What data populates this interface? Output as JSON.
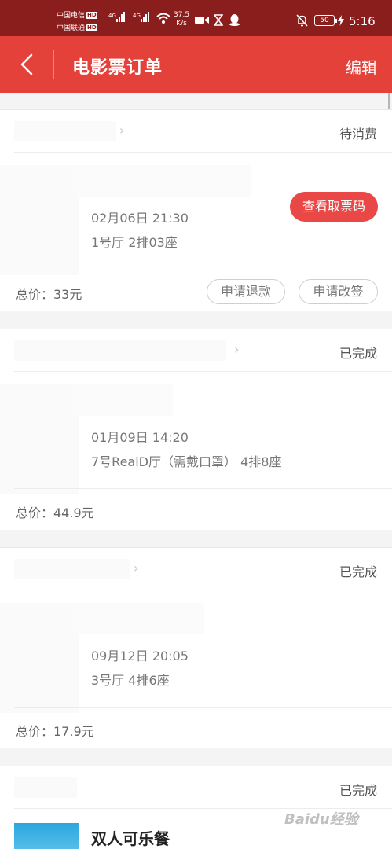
{
  "status_bar": {
    "carrier1": "中国电信",
    "carrier2": "中国联通",
    "hd_label": "HD",
    "sig_label": "4G",
    "net_speed_value": "37.5",
    "net_speed_unit": "K/s",
    "battery": "50",
    "time": "5:16"
  },
  "header": {
    "title": "电影票订单",
    "edit_label": "编辑"
  },
  "orders": [
    {
      "status": "待消费",
      "datetime": "02月06日 21:30",
      "seat": "1号厅 2排03座",
      "total": "总价：33元",
      "view_code_label": "查看取票码",
      "refund_label": "申请退款",
      "change_label": "申请改签"
    },
    {
      "status": "已完成",
      "datetime": "01月09日 14:20",
      "seat": "7号RealD厅（需戴口罩） 4排8座",
      "total": "总价：44.9元"
    },
    {
      "status": "已完成",
      "datetime": "09月12日 20:05",
      "seat": "3号厅 4排6座",
      "total": "总价：17.9元"
    },
    {
      "status": "已完成",
      "combo_name": "双人可乐餐"
    }
  ],
  "watermark": "Baidu经验"
}
